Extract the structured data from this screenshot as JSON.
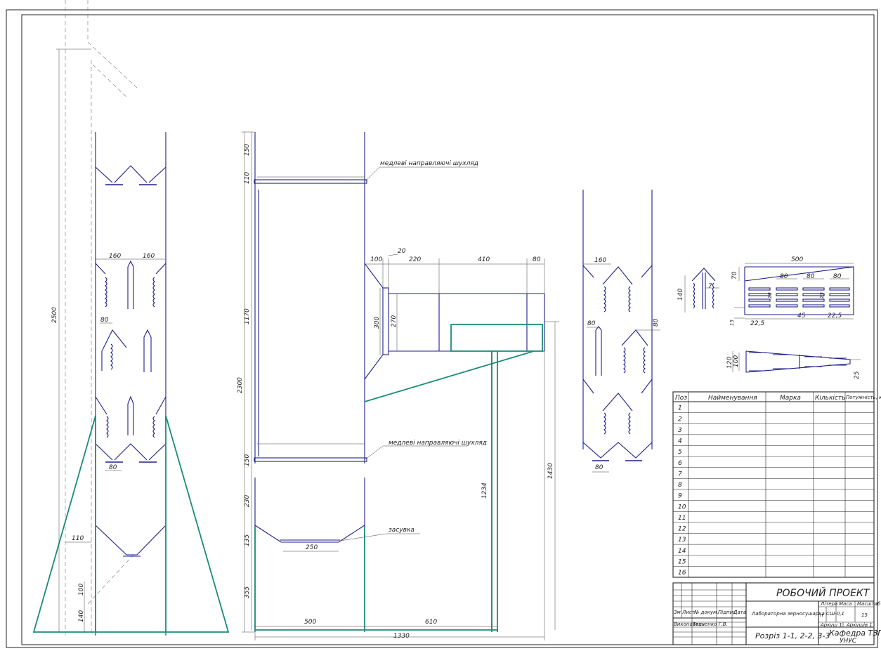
{
  "callouts": {
    "guides_top": "медлеві направляючі шухляд",
    "guides_bottom": "медлеві направляючі шухляд",
    "latch": "засувка"
  },
  "dims": {
    "d2500": "2500",
    "d160a": "160",
    "d160b": "160",
    "d80a": "80",
    "d80b": "80",
    "d110": "110",
    "d100": "100",
    "d140": "140",
    "d150a": "150",
    "d110b": "110",
    "d1170": "1170",
    "d2300": "2300",
    "d150b": "150",
    "d230": "230",
    "d135": "135",
    "d355": "355",
    "d250": "250",
    "d500a": "500",
    "d610a": "610",
    "d1330": "1330",
    "d1234": "1234",
    "d1430": "1430",
    "d100c": "100",
    "d20": "20",
    "d220": "220",
    "d410": "410",
    "d80c": "80",
    "d300": "300",
    "d270": "270",
    "d160c": "160",
    "d80d": "80",
    "d80e": "80",
    "d80f": "80",
    "d140b": "140",
    "d7": "7",
    "d500b": "500",
    "d70": "70",
    "d80g": "80",
    "d80h": "80",
    "d80i": "80",
    "d25a": "25",
    "d25b": "25",
    "d15": "15",
    "d225a": "22,5",
    "d45": "45",
    "d225b": "22,5",
    "d120": "120",
    "d100d": "100",
    "d25c": "25"
  },
  "spec_table": {
    "headers": [
      "Поз",
      "Найменування",
      "Марка",
      "Кількість",
      "Потужність, кВт"
    ],
    "positions": [
      "1",
      "2",
      "3",
      "4",
      "5",
      "6",
      "7",
      "8",
      "9",
      "10",
      "11",
      "12",
      "13",
      "14",
      "15",
      "16"
    ]
  },
  "title_block": {
    "project": "РОБОЧИЙ ПРОЕКТ",
    "col_zm": "Зм",
    "col_lyst": "Лист",
    "col_doc": "№ докум.",
    "col_sign": "Підпис",
    "col_date": "Дата",
    "role": "Виконавець",
    "author": "Ткаченко Г.В.",
    "designation": "Лабораторна зерносушарка СШ-0,1",
    "litera": "Літера",
    "mass": "Маса",
    "scale": "Масштаб",
    "scale_value": "15",
    "litera_value": "н",
    "sheet": "Аркуш 1",
    "sheets": "Аркушів 1",
    "sections": "Розріз 1-1, 2-2, 3-3",
    "dept_line1": "Кафедра ТЗПЗ",
    "dept_line2": "УНУС"
  },
  "colors": {
    "main_lines": "#1e1e8c",
    "hopper_lines": "#1a8c7a",
    "frame": "#222222"
  }
}
